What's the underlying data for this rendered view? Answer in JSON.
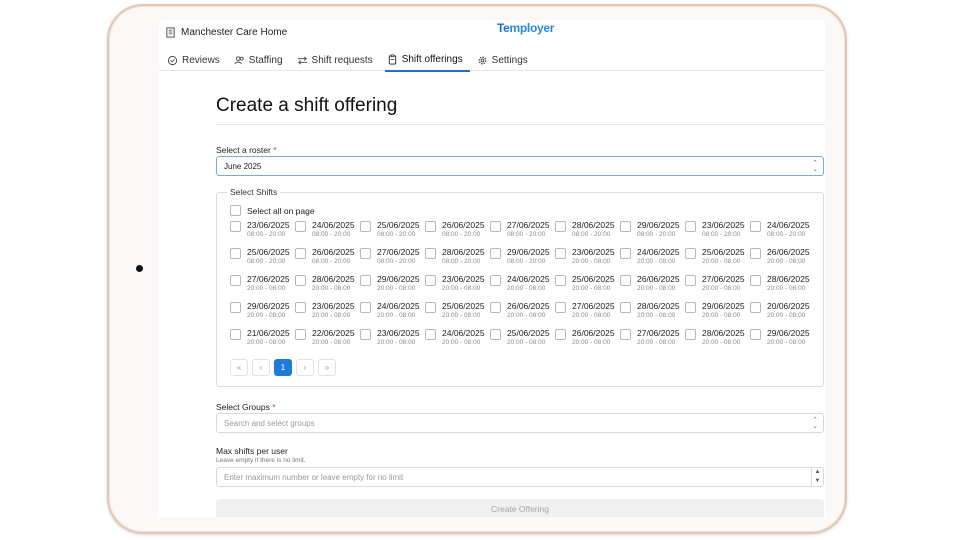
{
  "header": {
    "home_name": "Manchester Care Home",
    "logo_text_1": "Te",
    "logo_text_2": "mployer",
    "tabs": [
      {
        "label": "Reviews",
        "icon": "check-circle-icon"
      },
      {
        "label": "Staffing",
        "icon": "users-icon"
      },
      {
        "label": "Shift requests",
        "icon": "swap-arrows-icon"
      },
      {
        "label": "Shift offerings",
        "icon": "clipboard-icon",
        "active": true
      },
      {
        "label": "Settings",
        "icon": "gear-icon"
      }
    ]
  },
  "form": {
    "title": "Create a shift offering",
    "roster_label": "Select a roster",
    "required_mark": "*",
    "roster_value": "June 2025",
    "shifts_legend": "Select Shifts",
    "select_all_label": "Select all on page",
    "shifts": [
      {
        "date": "23/06/2025",
        "time": "08:00 - 20:00"
      },
      {
        "date": "24/06/2025",
        "time": "08:00 - 20:00"
      },
      {
        "date": "25/06/2025",
        "time": "08:00 - 20:00"
      },
      {
        "date": "26/06/2025",
        "time": "08:00 - 20:00"
      },
      {
        "date": "27/06/2025",
        "time": "08:00 - 20:00"
      },
      {
        "date": "28/06/2025",
        "time": "08:00 - 20:00"
      },
      {
        "date": "29/06/2025",
        "time": "08:00 - 20:00"
      },
      {
        "date": "23/06/2025",
        "time": "08:00 - 20:00"
      },
      {
        "date": "24/06/2025",
        "time": "08:00 - 20:00"
      },
      {
        "date": "25/06/2025",
        "time": "08:00 - 20:00"
      },
      {
        "date": "26/06/2025",
        "time": "08:00 - 20:00"
      },
      {
        "date": "27/06/2025",
        "time": "08:00 - 20:00"
      },
      {
        "date": "28/06/2025",
        "time": "08:00 - 20:00"
      },
      {
        "date": "29/06/2025",
        "time": "08:00 - 20:00"
      },
      {
        "date": "23/06/2025",
        "time": "20:00 - 08:00"
      },
      {
        "date": "24/06/2025",
        "time": "20:00 - 08:00"
      },
      {
        "date": "25/06/2025",
        "time": "20:00 - 08:00"
      },
      {
        "date": "26/06/2025",
        "time": "20:00 - 08:00"
      },
      {
        "date": "27/06/2025",
        "time": "20:00 - 08:00"
      },
      {
        "date": "28/06/2025",
        "time": "20:00 - 08:00"
      },
      {
        "date": "29/06/2025",
        "time": "20:00 - 08:00"
      },
      {
        "date": "23/06/2025",
        "time": "20:00 - 08:00"
      },
      {
        "date": "24/06/2025",
        "time": "20:00 - 08:00"
      },
      {
        "date": "25/06/2025",
        "time": "20:00 - 08:00"
      },
      {
        "date": "26/06/2025",
        "time": "20:00 - 08:00"
      },
      {
        "date": "27/06/2025",
        "time": "20:00 - 08:00"
      },
      {
        "date": "28/06/2025",
        "time": "20:00 - 08:00"
      },
      {
        "date": "29/06/2025",
        "time": "20:00 - 08:00"
      },
      {
        "date": "23/06/2025",
        "time": "20:00 - 08:00"
      },
      {
        "date": "24/06/2025",
        "time": "20:00 - 08:00"
      },
      {
        "date": "25/06/2025",
        "time": "20:00 - 08:00"
      },
      {
        "date": "26/06/2025",
        "time": "20:00 - 08:00"
      },
      {
        "date": "27/06/2025",
        "time": "20:00 - 08:00"
      },
      {
        "date": "28/06/2025",
        "time": "20:00 - 08:00"
      },
      {
        "date": "29/06/2025",
        "time": "20:00 - 08:00"
      },
      {
        "date": "20/06/2025",
        "time": "20:00 - 08:00"
      },
      {
        "date": "21/06/2025",
        "time": "20:00 - 08:00"
      },
      {
        "date": "22/06/2025",
        "time": "20:00 - 08:00"
      },
      {
        "date": "23/06/2025",
        "time": "20:00 - 08:00"
      },
      {
        "date": "24/06/2025",
        "time": "20:00 - 08:00"
      },
      {
        "date": "25/06/2025",
        "time": "20:00 - 08:00"
      },
      {
        "date": "26/06/2025",
        "time": "20:00 - 08:00"
      },
      {
        "date": "27/06/2025",
        "time": "20:00 - 08:00"
      },
      {
        "date": "28/06/2025",
        "time": "20:00 - 08:00"
      },
      {
        "date": "29/06/2025",
        "time": "20:00 - 08:00"
      }
    ],
    "pagination": {
      "first": "«",
      "prev": "‹",
      "current": "1",
      "next": "›",
      "last": "»"
    },
    "groups_label": "Select Groups",
    "groups_placeholder": "Search and select groups",
    "max_label": "Max shifts per user",
    "max_hint": "Leave empty if there is no limit.",
    "max_placeholder": "Enter maximum number or leave empty for no limit",
    "submit_label": "Create Offering"
  }
}
